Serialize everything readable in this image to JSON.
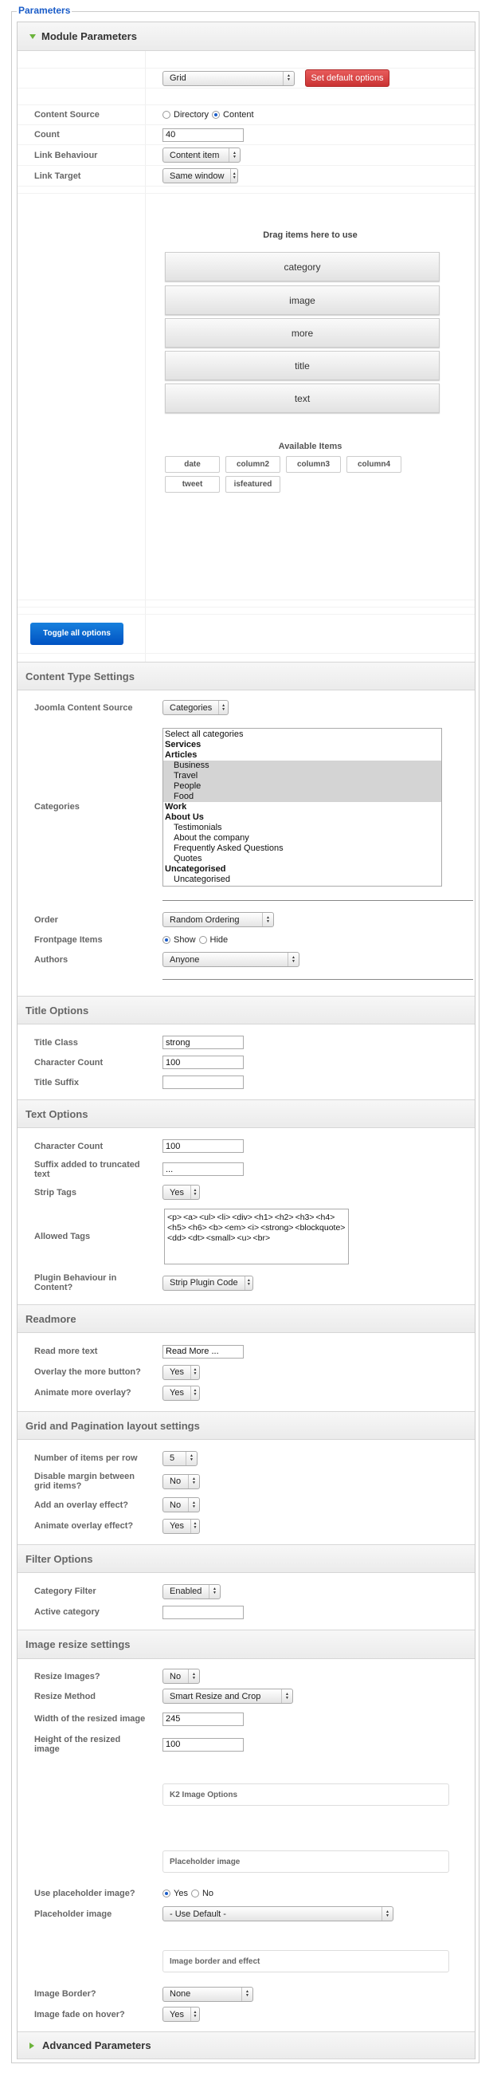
{
  "legend": "Parameters",
  "module": {
    "title": "Module Parameters",
    "layout_select": "Grid",
    "set_default": "Set default options",
    "content_source": {
      "label": "Content Source",
      "options": [
        "Directory",
        "Content"
      ],
      "selected": "Content"
    },
    "count": {
      "label": "Count",
      "value": "40"
    },
    "link_behaviour": {
      "label": "Link Behaviour",
      "value": "Content item"
    },
    "link_target": {
      "label": "Link Target",
      "value": "Same window"
    },
    "drag_title": "Drag items here to use",
    "used_items": [
      "category",
      "image",
      "more",
      "title",
      "text"
    ],
    "available_title": "Available Items",
    "available_items": [
      "date",
      "column2",
      "column3",
      "column4",
      "tweet",
      "isfeatured"
    ],
    "toggle": "Toggle all options"
  },
  "content_type": {
    "title": "Content Type Settings",
    "joomla_source": {
      "label": "Joomla Content Source",
      "value": "Categories"
    },
    "categories": {
      "label": "Categories",
      "items": [
        {
          "text": "Select all categories",
          "bold": false,
          "indent": false,
          "selected": false
        },
        {
          "text": "Services",
          "bold": true,
          "indent": false,
          "selected": false
        },
        {
          "text": "Articles",
          "bold": true,
          "indent": false,
          "selected": false
        },
        {
          "text": "Business",
          "bold": false,
          "indent": true,
          "selected": true
        },
        {
          "text": "Travel",
          "bold": false,
          "indent": true,
          "selected": true
        },
        {
          "text": "People",
          "bold": false,
          "indent": true,
          "selected": true
        },
        {
          "text": "Food",
          "bold": false,
          "indent": true,
          "selected": true
        },
        {
          "text": "Work",
          "bold": true,
          "indent": false,
          "selected": false
        },
        {
          "text": "About Us",
          "bold": true,
          "indent": false,
          "selected": false
        },
        {
          "text": "Testimonials",
          "bold": false,
          "indent": true,
          "selected": false
        },
        {
          "text": "About the company",
          "bold": false,
          "indent": true,
          "selected": false
        },
        {
          "text": "Frequently Asked Questions",
          "bold": false,
          "indent": true,
          "selected": false
        },
        {
          "text": "Quotes",
          "bold": false,
          "indent": true,
          "selected": false
        },
        {
          "text": "Uncategorised",
          "bold": true,
          "indent": false,
          "selected": false
        },
        {
          "text": "Uncategorised",
          "bold": false,
          "indent": true,
          "selected": false
        }
      ]
    },
    "order": {
      "label": "Order",
      "value": "Random Ordering"
    },
    "frontpage": {
      "label": "Frontpage Items",
      "options": [
        "Show",
        "Hide"
      ],
      "selected": "Show"
    },
    "authors": {
      "label": "Authors",
      "value": "Anyone"
    }
  },
  "title_options": {
    "title": "Title Options",
    "title_class": {
      "label": "Title Class",
      "value": "strong"
    },
    "char_count": {
      "label": "Character Count",
      "value": "100"
    },
    "suffix": {
      "label": "Title Suffix",
      "value": ""
    }
  },
  "text_options": {
    "title": "Text Options",
    "char_count": {
      "label": "Character Count",
      "value": "100"
    },
    "suffix": {
      "label": "Suffix added to truncated text",
      "value": "..."
    },
    "strip_tags": {
      "label": "Strip Tags",
      "value": "Yes"
    },
    "allowed_tags": {
      "label": "Allowed Tags",
      "value": "<p> <a> <ul> <li> <div> <h1> <h2> <h3> <h4> <h5> <h6> <b> <em> <i> <strong> <blockquote> <dd> <dt> <small> <u> <br>"
    },
    "plugin": {
      "label": "Plugin Behaviour in Content?",
      "value": "Strip Plugin Code"
    }
  },
  "readmore": {
    "title": "Readmore",
    "text": {
      "label": "Read more text",
      "value": "Read More ..."
    },
    "overlay": {
      "label": "Overlay the more button?",
      "value": "Yes"
    },
    "animate": {
      "label": "Animate more overlay?",
      "value": "Yes"
    }
  },
  "grid": {
    "title": "Grid and Pagination layout settings",
    "per_row": {
      "label": "Number of items per row",
      "value": "5"
    },
    "disable_margin": {
      "label": "Disable margin between grid items?",
      "value": "No"
    },
    "overlay": {
      "label": "Add an overlay effect?",
      "value": "No"
    },
    "animate": {
      "label": "Animate overlay effect?",
      "value": "Yes"
    }
  },
  "filter": {
    "title": "Filter Options",
    "category_filter": {
      "label": "Category Filter",
      "value": "Enabled"
    },
    "active_category": {
      "label": "Active category",
      "value": ""
    }
  },
  "image": {
    "title": "Image resize settings",
    "resize": {
      "label": "Resize Images?",
      "value": "No"
    },
    "method": {
      "label": "Resize Method",
      "value": "Smart Resize and Crop"
    },
    "width": {
      "label": "Width of the resized image",
      "value": "245"
    },
    "height": {
      "label": "Height of the resized image",
      "value": "100"
    },
    "k2_box": "K2 Image Options",
    "placeholder_box": "Placeholder image",
    "use_placeholder": {
      "label": "Use placeholder image?",
      "options": [
        "Yes",
        "No"
      ],
      "selected": "Yes"
    },
    "placeholder": {
      "label": "Placeholder image",
      "value": "- Use Default -"
    },
    "border_box": "Image border and effect",
    "border": {
      "label": "Image Border?",
      "value": "None"
    },
    "fade": {
      "label": "Image fade on hover?",
      "value": "Yes"
    }
  },
  "advanced": {
    "title": "Advanced Parameters"
  },
  "colors": {
    "legend": "#1a5cc8",
    "danger_button": "#d64040",
    "primary_button": "#0a6ad4",
    "expand_icon": "#6bb33a"
  }
}
